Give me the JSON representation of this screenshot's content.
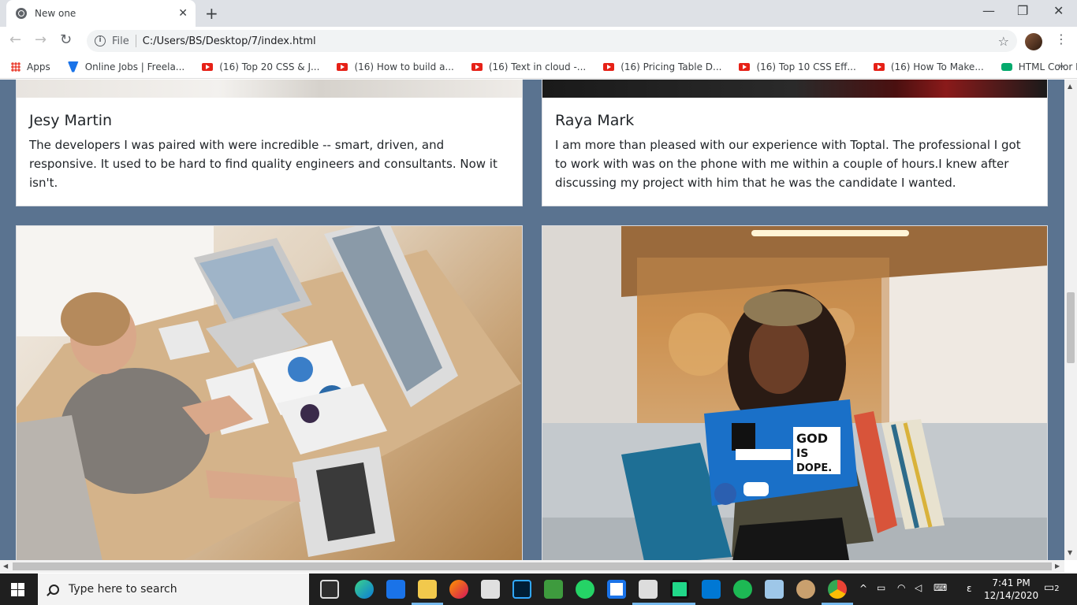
{
  "browser": {
    "tab_title": "New one",
    "url_scheme": "File",
    "url": "C:/Users/BS/Desktop/7/index.html",
    "bookmarks": [
      {
        "label": "Apps",
        "icon": "apps-icon"
      },
      {
        "label": "Online Jobs | Freela...",
        "icon": "upwork-icon"
      },
      {
        "label": "(16) Top 20 CSS & J...",
        "icon": "youtube-icon"
      },
      {
        "label": "(16) How to build a...",
        "icon": "youtube-icon"
      },
      {
        "label": "(16) Text in cloud -...",
        "icon": "youtube-icon"
      },
      {
        "label": "(16) Pricing Table D...",
        "icon": "youtube-icon"
      },
      {
        "label": "(16) Top 10 CSS Eff...",
        "icon": "youtube-icon"
      },
      {
        "label": "(16) How To Make...",
        "icon": "youtube-icon"
      },
      {
        "label": "HTML Color Names",
        "icon": "w3schools-icon"
      }
    ]
  },
  "page": {
    "background_color": "#5a7390",
    "testimonials": [
      {
        "name": "Jesy Martin",
        "text": "The developers I was paired with were incredible -- smart, driven, and responsive. It used to be hard to find quality engineers and consultants. Now it isn't."
      },
      {
        "name": "Raya Mark",
        "text": "I am more than pleased with our experience with Toptal. The professional I got to work with was on the phone with me within a couple of hours.I knew after discussing my project with him that he was the candidate I wanted."
      }
    ],
    "photos": [
      {
        "name": "developer-desk-photo",
        "description": ""
      },
      {
        "name": "woman-laptop-stickers-photo",
        "laptop_sticker_text": "GOD IS DOPE."
      }
    ]
  },
  "taskbar": {
    "search_placeholder": "Type here to search",
    "time": "7:41 PM",
    "date": "12/14/2020",
    "notification_count": "2"
  }
}
